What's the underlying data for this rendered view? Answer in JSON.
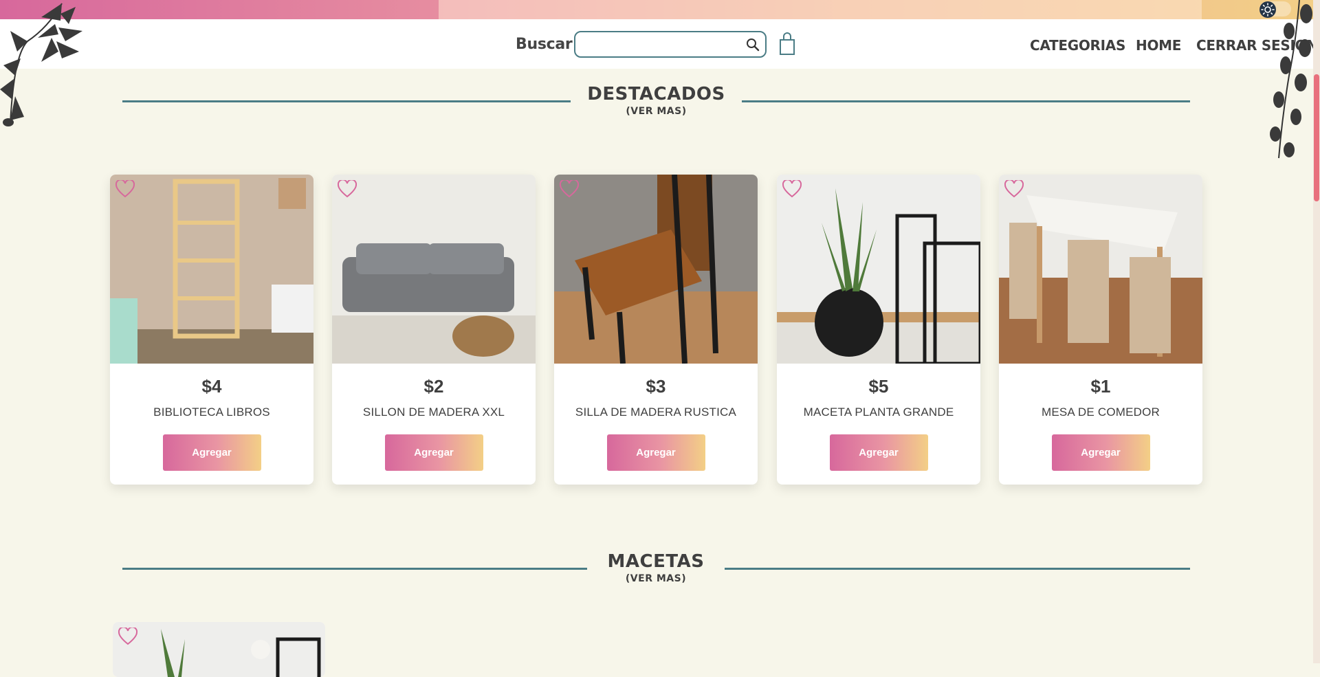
{
  "header": {
    "search_label": "Buscar",
    "search_value": "",
    "nav": [
      "CATEGORIAS",
      "HOME",
      "CERRAR SESION"
    ]
  },
  "sections": [
    {
      "title": "DESTACADOS",
      "more": "(VER MAS)"
    },
    {
      "title": "MACETAS",
      "more": "(VER MAS)"
    }
  ],
  "products": [
    {
      "price": "$4",
      "name": "BIBLIOTECA LIBROS",
      "button": "Agregar"
    },
    {
      "price": "$2",
      "name": "SILLON DE MADERA XXL",
      "button": "Agregar"
    },
    {
      "price": "$3",
      "name": "SILLA DE MADERA RUSTICA",
      "button": "Agregar"
    },
    {
      "price": "$5",
      "name": "MACETA PLANTA GRANDE",
      "button": "Agregar"
    },
    {
      "price": "$1",
      "name": "MESA DE COMEDOR",
      "button": "Agregar"
    }
  ],
  "colors": {
    "accent_teal": "#4a7c85",
    "pink": "#d7689c",
    "gold": "#f3cf86",
    "background": "#f7f6ea"
  },
  "icons": [
    "search-icon",
    "shopping-bag-icon",
    "heart-icon",
    "sun-icon",
    "leaf-vine-decoration"
  ]
}
